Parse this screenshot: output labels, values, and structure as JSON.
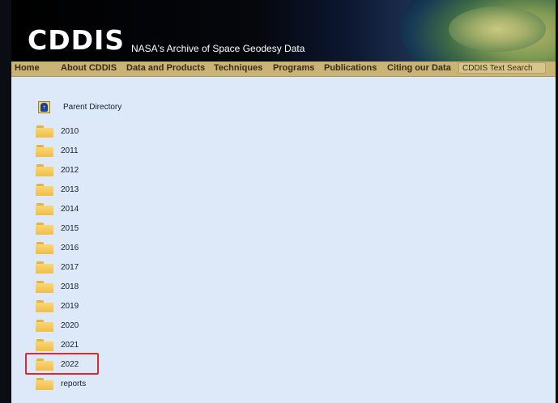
{
  "header": {
    "logo": "CDDIS",
    "tagline": "NASA's Archive of Space Geodesy Data"
  },
  "nav": {
    "items": [
      {
        "label": "Home"
      },
      {
        "label": "About CDDIS"
      },
      {
        "label": "Data and Products"
      },
      {
        "label": "Techniques"
      },
      {
        "label": "Programs"
      },
      {
        "label": "Publications"
      },
      {
        "label": "Citing our Data"
      }
    ],
    "search_label": "CDDIS Text Search"
  },
  "listing": {
    "parent_label": "Parent Directory",
    "folders": [
      "2010",
      "2011",
      "2012",
      "2013",
      "2014",
      "2015",
      "2016",
      "2017",
      "2018",
      "2019",
      "2020",
      "2021",
      "2022",
      "reports"
    ],
    "highlighted": "2022"
  },
  "colors": {
    "nav_bg": "#c9b476",
    "content_bg": "#dde8f8",
    "highlight": "#e02a2a"
  }
}
